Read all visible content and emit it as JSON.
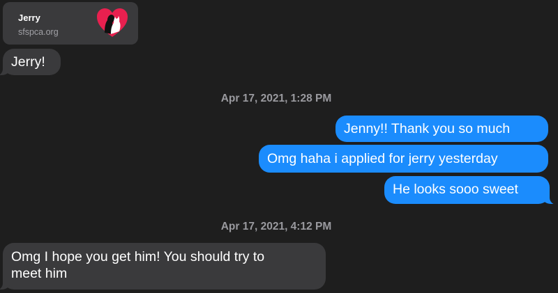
{
  "link_preview": {
    "title": "Jerry",
    "domain": "sfspca.org",
    "logo_icon": "sfspca-heart-logo",
    "logo_color": "#e8204f"
  },
  "messages": [
    {
      "direction": "incoming",
      "text": "Jerry!"
    },
    {
      "timestamp": "Apr 17, 2021, 1:28 PM"
    },
    {
      "direction": "outgoing",
      "text": "Jenny!! Thank you so much"
    },
    {
      "direction": "outgoing",
      "text": "Omg haha i applied for jerry yesterday"
    },
    {
      "direction": "outgoing",
      "text": "He looks sooo sweet"
    },
    {
      "timestamp": "Apr 17, 2021, 4:12 PM"
    },
    {
      "direction": "incoming",
      "text_line1": "Omg I hope you get him! You should try to",
      "text_line2": "meet him"
    }
  ],
  "colors": {
    "background": "#1e1e1e",
    "incoming_bubble": "#3a3a3c",
    "outgoing_bubble": "#1b8cfd",
    "timestamp_text": "#9a9a9f"
  }
}
